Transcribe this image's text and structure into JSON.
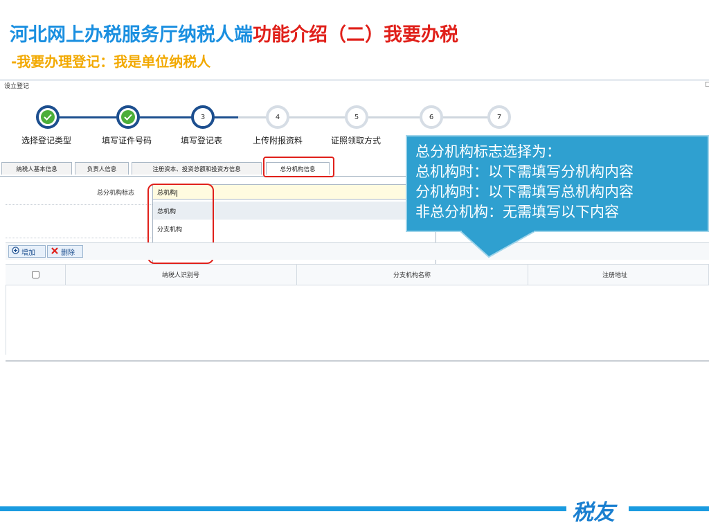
{
  "slide": {
    "title_part1": "河北网上办税服务厅纳税人端",
    "title_part2": "功能介绍（二）我要办税",
    "subtitle": "-我要办理登记：我是单位纳税人"
  },
  "window": {
    "title": "设立登记",
    "corner_glyph": "□"
  },
  "steps": [
    {
      "number": "1",
      "label": "选择登记类型",
      "status": "done"
    },
    {
      "number": "2",
      "label": "填写证件号码",
      "status": "done"
    },
    {
      "number": "3",
      "label": "填写登记表",
      "status": "current"
    },
    {
      "number": "4",
      "label": "上传附报资料",
      "status": "todo"
    },
    {
      "number": "5",
      "label": "证照领取方式",
      "status": "todo"
    },
    {
      "number": "6",
      "label": "",
      "status": "todo"
    },
    {
      "number": "7",
      "label": "",
      "status": "todo"
    }
  ],
  "tabs": [
    {
      "label": "纳税人基本信息",
      "active": false
    },
    {
      "label": "负责人信息",
      "active": false
    },
    {
      "label": "注册资本、投资总额和投资方信息",
      "active": false
    },
    {
      "label": "总分机构信息",
      "active": true
    }
  ],
  "form": {
    "field_label": "总分机构标志",
    "field_value": "总机构",
    "options": [
      "总机构",
      "分支机构",
      "非总分机构"
    ],
    "highlighted_option": "总机构"
  },
  "toolbar": {
    "add_label": "增加",
    "delete_label": "删除"
  },
  "grid": {
    "columns": [
      "纳税人识别号",
      "分支机构名称",
      "注册地址"
    ],
    "rows": []
  },
  "callout": {
    "lines": [
      "总分机构标志选择为：",
      "总机构时：以下需填写分机构内容",
      "分机构时：以下需填写总机构内容",
      "非总分机构：无需填写以下内容"
    ]
  },
  "footer": {
    "logo_text": "税友"
  },
  "colors": {
    "title_blue": "#1a8fe0",
    "title_red": "#e0201a",
    "subtitle_orange": "#f2a900",
    "step_done": "#1d4f8f",
    "check_green": "#4cae3a",
    "callout_bg": "#2fa0d0",
    "highlight_red": "#e0201a"
  }
}
